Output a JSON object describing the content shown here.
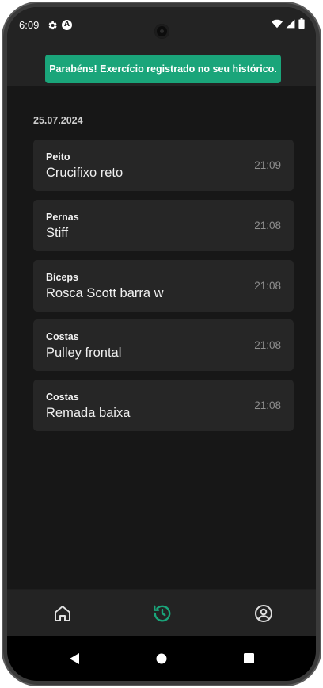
{
  "status_bar": {
    "time": "6:09",
    "left_icons": [
      "gear-icon",
      "a-badge-icon"
    ],
    "a_badge_text": "A",
    "right_icons": [
      "wifi-icon",
      "signal-icon",
      "battery-icon"
    ]
  },
  "toast": {
    "message": "Parabéns! Exercício registrado no seu histórico.",
    "background_color": "#1aa57a"
  },
  "history": {
    "date": "25.07.2024",
    "entries": [
      {
        "muscle": "Peito",
        "exercise": "Crucifixo reto",
        "time": "21:09"
      },
      {
        "muscle": "Pernas",
        "exercise": "Stiff",
        "time": "21:08"
      },
      {
        "muscle": "Bíceps",
        "exercise": "Rosca Scott barra w",
        "time": "21:08"
      },
      {
        "muscle": "Costas",
        "exercise": "Pulley frontal",
        "time": "21:08"
      },
      {
        "muscle": "Costas",
        "exercise": "Remada baixa",
        "time": "21:08"
      }
    ]
  },
  "bottom_nav": {
    "items": [
      {
        "icon": "home-icon",
        "active": false
      },
      {
        "icon": "history-icon",
        "active": true
      },
      {
        "icon": "profile-icon",
        "active": false
      }
    ],
    "active_color": "#1aa57a",
    "inactive_color": "#e0e0e0"
  },
  "system_nav": {
    "buttons": [
      "back-icon",
      "home-circle-icon",
      "recents-icon"
    ]
  },
  "colors": {
    "background": "#171717",
    "card": "#262626",
    "bars": "#232323"
  }
}
